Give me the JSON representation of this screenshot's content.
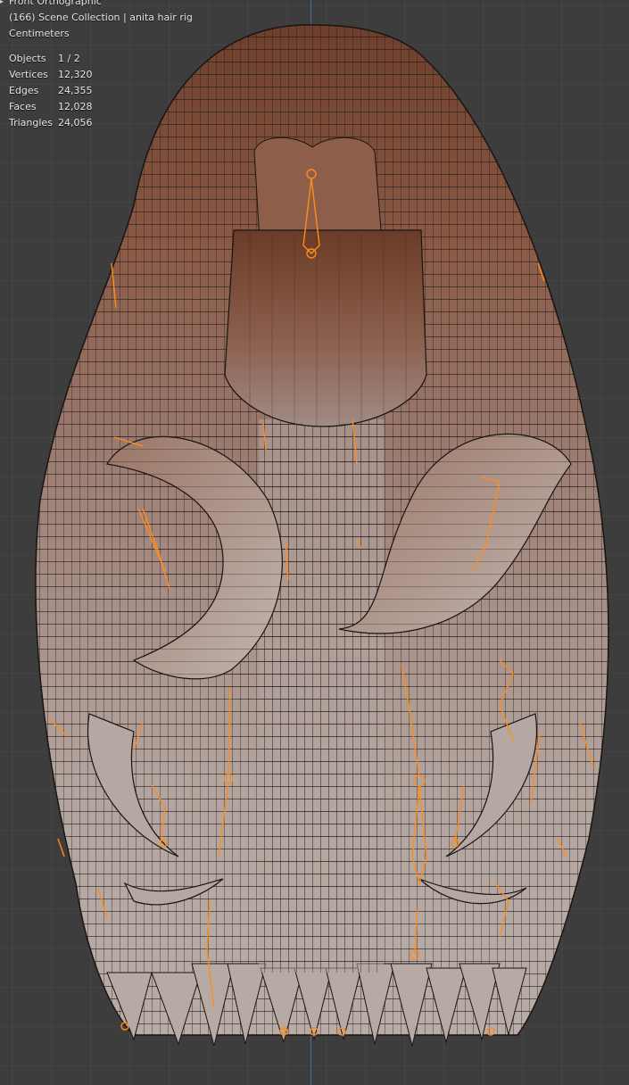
{
  "viewport": {
    "view_name": "Front Orthographic",
    "collection_line": "(166) Scene Collection | anita hair rig",
    "units": "Centimeters",
    "stats": [
      {
        "label": "Objects",
        "value": "1 / 2"
      },
      {
        "label": "Vertices",
        "value": "12,320"
      },
      {
        "label": "Edges",
        "value": "24,355"
      },
      {
        "label": "Faces",
        "value": "12,028"
      },
      {
        "label": "Triangles",
        "value": "24,056"
      }
    ],
    "colors": {
      "background": "#3d3d3d",
      "z_axis": "#4f6fb5",
      "bone_select": "#ff8c1a",
      "hair_root": "#7a4a36",
      "hair_tip": "#b8aaa4",
      "wire": "#1e1a18"
    },
    "object_icon": "armature-bone-icon",
    "mesh_icon": "hair-mesh"
  }
}
